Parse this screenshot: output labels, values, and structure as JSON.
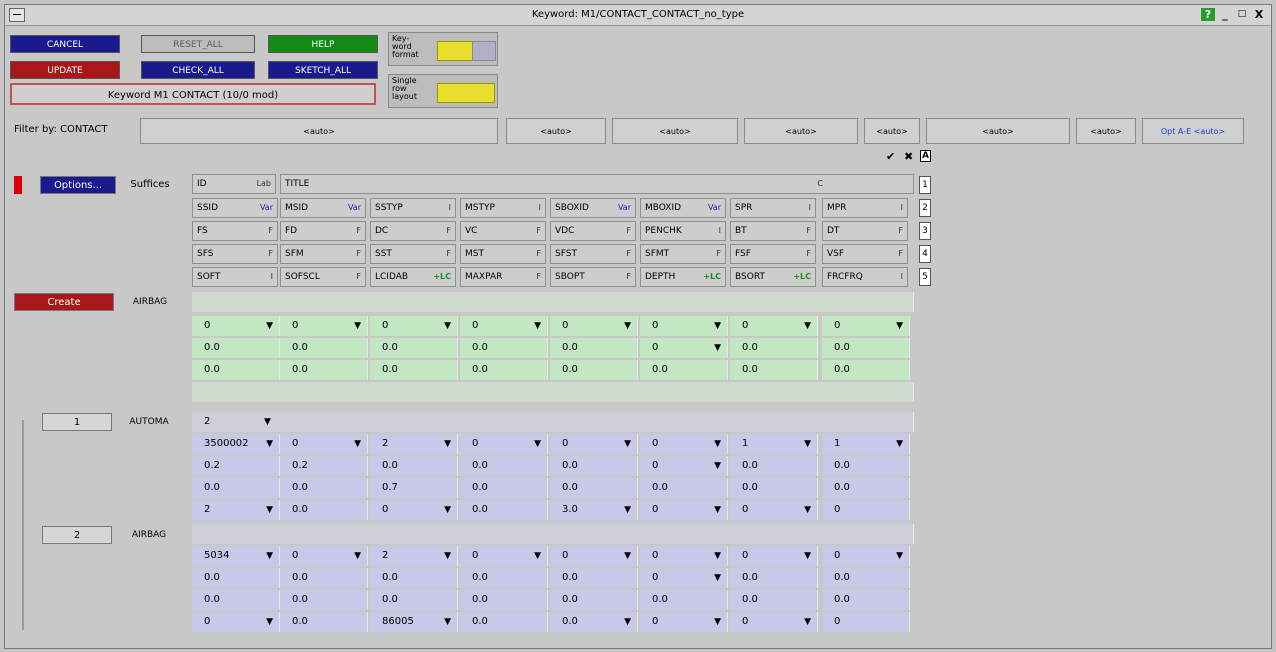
{
  "window": {
    "title": "Keyword: M1/CONTACT_CONTACT_no_type",
    "help_icon": "?",
    "minimize": "_",
    "restore": "□",
    "close": "X"
  },
  "toolbar": {
    "cancel": "CANCEL",
    "reset_all": "RESET_ALL",
    "help": "HELP",
    "update": "UPDATE",
    "check_all": "CHECK_ALL",
    "sketch_all": "SKETCH_ALL",
    "keyword_label": "Keyword M1 CONTACT (10/0 mod)",
    "kw_format_label": "Key-word format",
    "single_row_label": "Single row layout"
  },
  "filter": {
    "label": "Filter by: CONTACT",
    "boxes": [
      "<auto>",
      "<auto>",
      "<auto>",
      "<auto>",
      "<auto>",
      "<auto>",
      "<auto>"
    ],
    "opt": "Opt A-E <auto>"
  },
  "ticks": {
    "check": "✔",
    "cross": "✖",
    "a": "A"
  },
  "left": {
    "options": "Options...",
    "suffices": "Suffices",
    "create": "Create",
    "create_kw": "AIRBAG"
  },
  "headers": {
    "row1": {
      "id": "ID",
      "lab": "Lab",
      "title": "TITLE",
      "c": "C"
    },
    "rows": [
      [
        [
          "SSID",
          "Var"
        ],
        [
          "MSID",
          "Var"
        ],
        [
          "SSTYP",
          "I"
        ],
        [
          "MSTYP",
          "I"
        ],
        [
          "SBOXID",
          "Var"
        ],
        [
          "MBOXID",
          "Var"
        ],
        [
          "SPR",
          "I"
        ],
        [
          "MPR",
          "I"
        ]
      ],
      [
        [
          "FS",
          "F"
        ],
        [
          "FD",
          "F"
        ],
        [
          "DC",
          "F"
        ],
        [
          "VC",
          "F"
        ],
        [
          "VDC",
          "F"
        ],
        [
          "PENCHK",
          "I"
        ],
        [
          "BT",
          "F"
        ],
        [
          "DT",
          "F"
        ]
      ],
      [
        [
          "SFS",
          "F"
        ],
        [
          "SFM",
          "F"
        ],
        [
          "SST",
          "F"
        ],
        [
          "MST",
          "F"
        ],
        [
          "SFST",
          "F"
        ],
        [
          "SFMT",
          "F"
        ],
        [
          "FSF",
          "F"
        ],
        [
          "VSF",
          "F"
        ]
      ],
      [
        [
          "SOFT",
          "I"
        ],
        [
          "SOFSCL",
          "F"
        ],
        [
          "LCIDAB",
          "+LC"
        ],
        [
          "MAXPAR",
          "F"
        ],
        [
          "SBOPT",
          "F"
        ],
        [
          "DEPTH",
          "+LC"
        ],
        [
          "BSORT",
          "+LC"
        ],
        [
          "FRCFRQ",
          "I"
        ]
      ]
    ],
    "row_numbers": [
      "1",
      "2",
      "3",
      "4",
      "5"
    ]
  },
  "create_block": {
    "rows": [
      [
        "0",
        "0",
        "0",
        "0",
        "0",
        "0",
        "0",
        "0"
      ],
      [
        "0.0",
        "0.0",
        "0.0",
        "0.0",
        "0.0",
        "0",
        "0.0",
        "0.0"
      ],
      [
        "0.0",
        "0.0",
        "0.0",
        "0.0",
        "0.0",
        "0.0",
        "0.0",
        "0.0"
      ]
    ]
  },
  "entries": [
    {
      "num": "1",
      "type": "AUTOMA",
      "id": "2",
      "rows": [
        [
          "3500002",
          "0",
          "2",
          "0",
          "0",
          "0",
          "1",
          "1"
        ],
        [
          "0.2",
          "0.2",
          "0.0",
          "0.0",
          "0.0",
          "0",
          "0.0",
          "0.0"
        ],
        [
          "0.0",
          "0.0",
          "0.7",
          "0.0",
          "0.0",
          "0.0",
          "0.0",
          "0.0"
        ],
        [
          "2",
          "0.0",
          "0",
          "0.0",
          "3.0",
          "0",
          "0",
          "0"
        ]
      ]
    },
    {
      "num": "2",
      "type": "AIRBAG",
      "id": "",
      "rows": [
        [
          "5034",
          "0",
          "2",
          "0",
          "0",
          "0",
          "0",
          "0"
        ],
        [
          "0.0",
          "0.0",
          "0.0",
          "0.0",
          "0.0",
          "0",
          "0.0",
          "0.0"
        ],
        [
          "0.0",
          "0.0",
          "0.0",
          "0.0",
          "0.0",
          "0.0",
          "0.0",
          "0.0"
        ],
        [
          "0",
          "0.0",
          "86005",
          "0.0",
          "0.0",
          "0",
          "0",
          "0"
        ]
      ]
    }
  ],
  "colors": {
    "cancel": "#1a1a8e",
    "update": "#a81818",
    "help": "#138a13",
    "green_row": "#c3e6c3",
    "purple_row": "#c8c8e8"
  }
}
